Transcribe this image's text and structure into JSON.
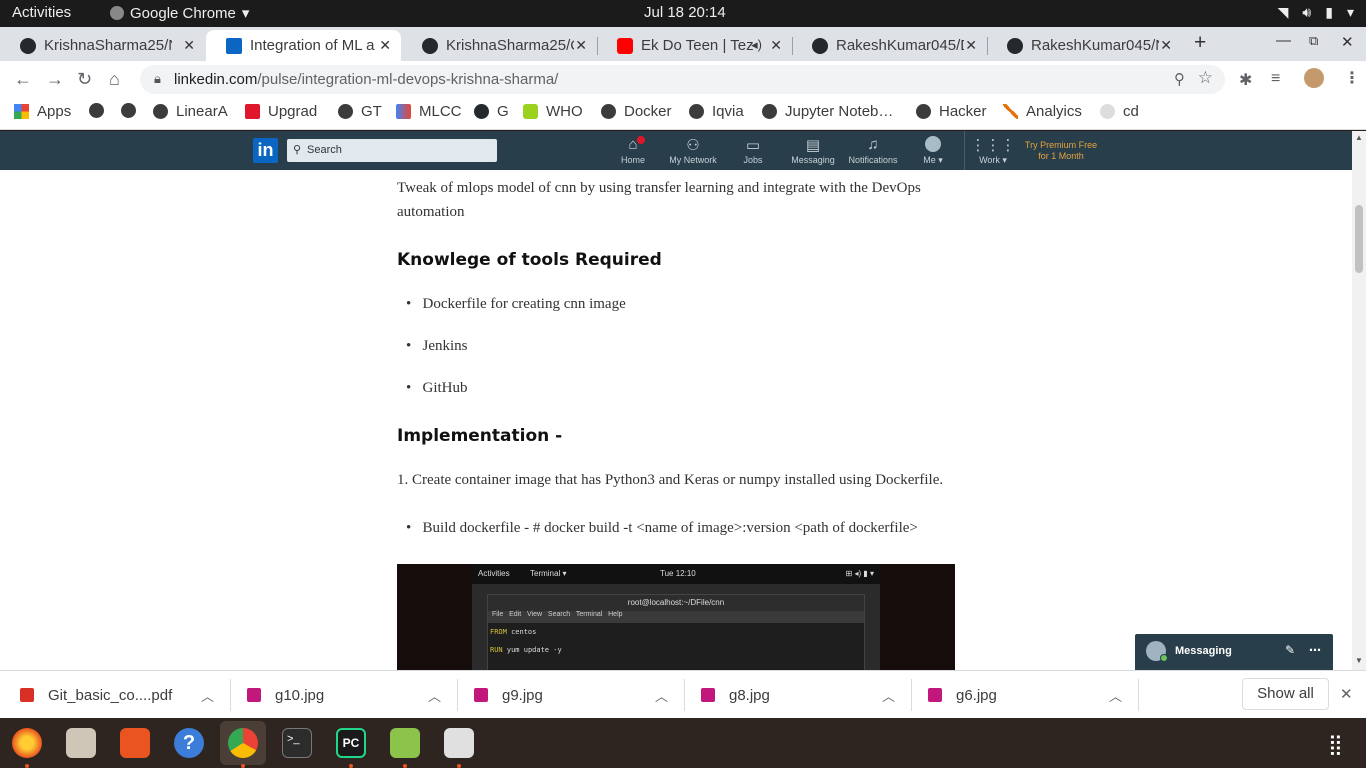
{
  "system_bar": {
    "activities": "Activities",
    "app_name": "Google Chrome",
    "clock": "Jul 18  20:14"
  },
  "tabs": [
    {
      "title": "KrishnaSharma25/N",
      "favicon": "github-icon"
    },
    {
      "title": "Integration of ML a",
      "favicon": "linkedin-icon"
    },
    {
      "title": "KrishnaSharma25/C",
      "favicon": "github-icon"
    },
    {
      "title": "Ek Do Teen | Tez",
      "favicon": "youtube-icon"
    },
    {
      "title": "RakeshKumar045/D",
      "favicon": "github-icon"
    },
    {
      "title": "RakeshKumar045/N",
      "favicon": "github-icon"
    }
  ],
  "address_bar": {
    "domain": "linkedin.com",
    "path": "/pulse/integration-ml-devops-krishna-sharma/"
  },
  "bookmarks": [
    "Apps",
    "",
    "",
    "LinearA",
    "Upgrad",
    "GT",
    "MLCC",
    "G",
    "WHO",
    "Docker",
    "Iqvia",
    "Jupyter Noteb…",
    "Hacker",
    "Analyics",
    "cd"
  ],
  "linkedin_nav": {
    "search_placeholder": "Search",
    "items": [
      "Home",
      "My Network",
      "Jobs",
      "Messaging",
      "Notifications",
      "Me",
      "Work"
    ],
    "premium_line1": "Try Premium Free",
    "premium_line2": "for 1 Month"
  },
  "article": {
    "intro_line1": "Tweak of mlops model of cnn by using transfer learning and integrate with the DevOps",
    "intro_line2": "automation",
    "heading_tools": "Knowlege of tools Required",
    "tools": [
      "Dockerfile for creating cnn image",
      "Jenkins",
      "GitHub"
    ],
    "heading_impl": "Implementation -",
    "step1": "1. Create container image that has Python3 and Keras or numpy installed using Dockerfile.",
    "bullet_build": "Build dockerfile - # docker build -t <name of image>:version <path of dockerfile>",
    "screenshot": {
      "activities": "Activities",
      "terminal_menu": "Terminal ▾",
      "clock": "Tue 12:10",
      "window_title": "root@localhost:~/DFile/cnn",
      "menu": [
        "File",
        "Edit",
        "View",
        "Search",
        "Terminal",
        "Help"
      ],
      "code_line1_kw": "FROM",
      "code_line1_rest": " centos",
      "code_line2_kw": "RUN",
      "code_line2_rest": " yum update -y"
    }
  },
  "messaging_widget": {
    "label": "Messaging"
  },
  "downloads": [
    {
      "name": "Git_basic_co....pdf",
      "type": "pdf"
    },
    {
      "name": "g10.jpg",
      "type": "image"
    },
    {
      "name": "g9.jpg",
      "type": "image"
    },
    {
      "name": "g8.jpg",
      "type": "image"
    },
    {
      "name": "g6.jpg",
      "type": "image"
    }
  ],
  "show_all": "Show all",
  "colors": {
    "linkedin_nav": "#283e4a",
    "linkedin_blue": "#0a66c2",
    "premium_gold": "#e7a33e",
    "ubuntu_orange": "#e95420"
  }
}
